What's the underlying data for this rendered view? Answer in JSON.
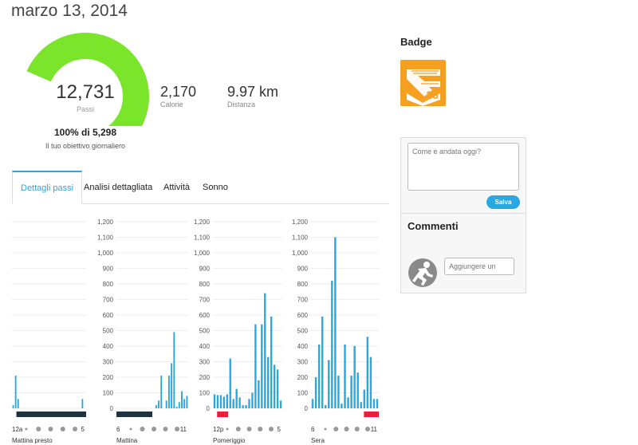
{
  "page": {
    "date_title": "marzo 13, 2014"
  },
  "summary": {
    "steps_value": "12,731",
    "steps_label": "Passi",
    "goal_text": "100% di 5,298",
    "goal_subtitle": "Il tuo obiettivo giornaliero",
    "goal_fraction": 1.0,
    "gauge_color": "#7ae52a",
    "calories_value": "2,170",
    "calories_label": "Calorie",
    "distance_value": "9.97 km",
    "distance_label": "Distanza"
  },
  "tabs": [
    {
      "label": "Dettagli passi",
      "active": true
    },
    {
      "label": "Analisi dettagliata",
      "active": false
    },
    {
      "label": "Attività",
      "active": false
    },
    {
      "label": "Sonno",
      "active": false
    }
  ],
  "badge": {
    "title": "Badge",
    "number": "25",
    "color": "#f5a021"
  },
  "comments": {
    "placeholder": "Come è andata oggi?",
    "save_label": "Salva",
    "title": "Commenti",
    "add_placeholder": "Aggiungere un"
  },
  "chart_data": {
    "type": "bar",
    "ylim": [
      0,
      1200
    ],
    "y_ticks": [
      "0",
      "100",
      "200",
      "300",
      "400",
      "500",
      "600",
      "700",
      "800",
      "900",
      "1,000",
      "1,100",
      "1,200"
    ],
    "bar_color": "#2aa8e0",
    "panels": [
      {
        "label": "Mattina presto",
        "tick_start": "12a",
        "tick_end": "5",
        "show_axis": false,
        "values": [
          20,
          210,
          60,
          0,
          0,
          0,
          0,
          0,
          0,
          0,
          0,
          0,
          0,
          0,
          0,
          0,
          0,
          0,
          0,
          0,
          0,
          0,
          0,
          0,
          0,
          0,
          0,
          0,
          60,
          0
        ],
        "activity_bar": {
          "color": "#1f3240",
          "from": 0.06,
          "to": 1.0
        }
      },
      {
        "label": "Mattina",
        "tick_start": "6",
        "tick_end": "11",
        "show_axis": true,
        "values": [
          0,
          0,
          0,
          0,
          0,
          0,
          0,
          0,
          0,
          0,
          0,
          0,
          0,
          0,
          0,
          20,
          50,
          210,
          0,
          50,
          210,
          290,
          490,
          10,
          40,
          110,
          60,
          80
        ],
        "activity_bar": {
          "color": "#1f3240",
          "from": 0.0,
          "to": 0.5
        }
      },
      {
        "label": "Pomeriggio",
        "tick_start": "12p",
        "tick_end": "5",
        "show_axis": true,
        "values": [
          90,
          85,
          85,
          75,
          90,
          320,
          60,
          125,
          70,
          20,
          20,
          60,
          100,
          540,
          180,
          540,
          740,
          330,
          590,
          280,
          250,
          50
        ],
        "activity_bar": {
          "color": "#ee1c3a",
          "from": 0.06,
          "to": 0.22
        }
      },
      {
        "label": "Sera",
        "tick_start": "6",
        "tick_end": "11",
        "show_axis": true,
        "values": [
          60,
          200,
          410,
          590,
          20,
          310,
          820,
          1100,
          210,
          30,
          410,
          70,
          210,
          400,
          230,
          40,
          120,
          460,
          330,
          60,
          60
        ],
        "activity_bar": {
          "color": "#ee1c3a",
          "from": 0.78,
          "to": 1.0
        }
      }
    ]
  }
}
